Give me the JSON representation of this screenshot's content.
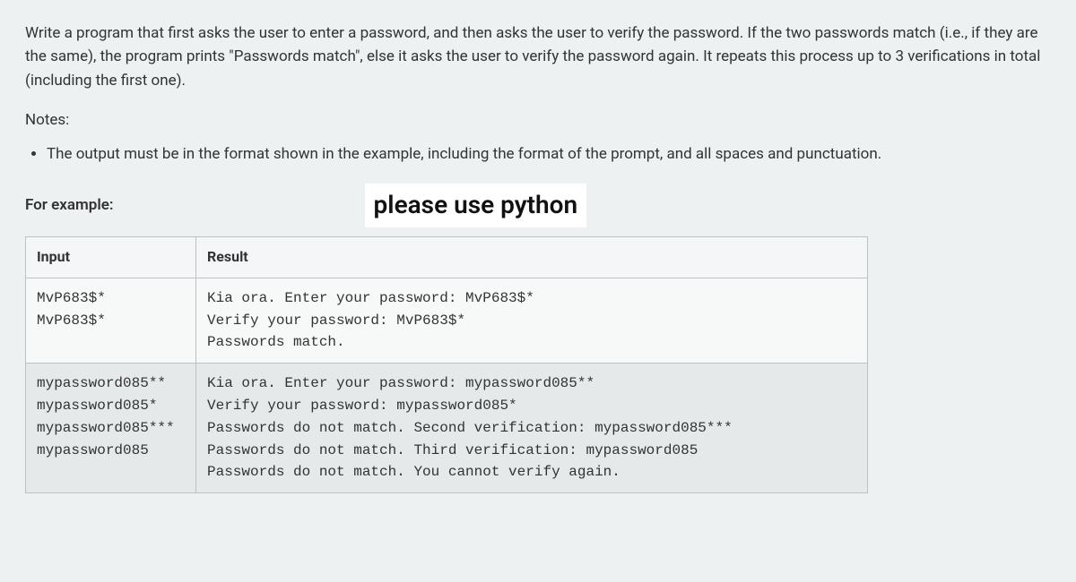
{
  "description": "Write a program that first asks the user to enter a password, and then asks the user to verify the password. If the two passwords match (i.e., if they are the same), the program prints \"Passwords match\", else it asks the user to verify the password again. It repeats this process up to 3 verifications in total (including the first one).",
  "notes_label": "Notes:",
  "notes": [
    "The output must be in the format shown in the example, including the format of the prompt, and all spaces and punctuation."
  ],
  "example_label": "For example:",
  "python_callout": "please use python",
  "table": {
    "headers": {
      "input": "Input",
      "result": "Result"
    },
    "rows": [
      {
        "input": "MvP683$*\nMvP683$*",
        "result": "Kia ora. Enter your password: MvP683$*\nVerify your password: MvP683$*\nPasswords match."
      },
      {
        "input": "mypassword085**\nmypassword085*\nmypassword085***\nmypassword085",
        "result": "Kia ora. Enter your password: mypassword085**\nVerify your password: mypassword085*\nPasswords do not match. Second verification: mypassword085***\nPasswords do not match. Third verification: mypassword085\nPasswords do not match. You cannot verify again."
      }
    ]
  }
}
